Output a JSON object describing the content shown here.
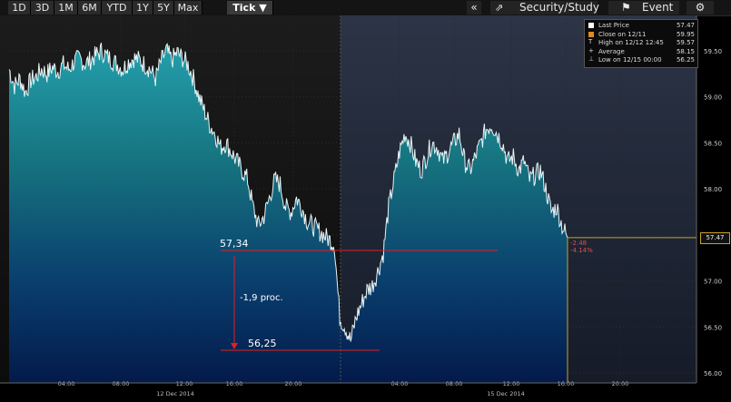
{
  "toolbar": {
    "ranges": [
      "1D",
      "3D",
      "1M",
      "6M",
      "YTD",
      "1Y",
      "5Y",
      "Max"
    ],
    "tick_label": "Tick",
    "tick_arrow": "▼",
    "collapse_label": "«",
    "security_label": "Security/Study",
    "event_label": "Event"
  },
  "legend": [
    {
      "label": "Last Price",
      "value": "57.47"
    },
    {
      "label": "Close on 12/11",
      "value": "59.95"
    },
    {
      "label": "High on 12/12 12:45",
      "value": "59.57"
    },
    {
      "label": "Average",
      "value": "58.15"
    },
    {
      "label": "Low on 12/15 00:00",
      "value": "56.25"
    }
  ],
  "price_tag": "57.47",
  "change": {
    "abs": "-2.48",
    "pct": "-4.14%"
  },
  "annotations": {
    "high_label": "57,34",
    "low_label": "56,25",
    "drop_label": "-1,9 proc."
  },
  "colors": {
    "accent_gold": "#c9a227",
    "annotation_red": "#e02020",
    "area_top": "#1f8a99",
    "area_bottom": "#04205a"
  },
  "chart_data": {
    "type": "area",
    "ylim": [
      56.0,
      59.6
    ],
    "y_ticks": [
      "59.50",
      "59.00",
      "58.50",
      "58.00",
      "57.50",
      "57.00",
      "56.50",
      "56.00"
    ],
    "x_ticks": [
      "04:00",
      "08:00",
      "12:00",
      "16:00",
      "20:00",
      "04:00",
      "08:00",
      "12:00",
      "16:00",
      "20:00"
    ],
    "day_labels": [
      "12 Dec 2014",
      "15 Dec 2014"
    ],
    "series": [
      {
        "values": [
          59.3,
          59.12,
          59.2,
          59.05,
          59.18,
          59.22,
          59.3,
          59.25,
          59.32,
          59.28,
          59.35,
          59.3,
          59.38,
          59.42,
          59.36,
          59.4,
          59.45,
          59.5,
          59.44,
          59.4,
          59.35,
          59.3,
          59.38,
          59.42,
          59.4,
          59.35,
          59.3,
          59.2,
          59.38,
          59.5,
          59.4,
          59.48,
          59.42,
          59.35,
          59.2,
          59.0,
          58.85,
          58.7,
          58.6,
          58.45,
          58.5,
          58.4,
          58.3,
          58.2,
          58.1,
          57.8,
          57.6,
          57.7,
          57.9,
          58.1,
          58.05,
          57.8,
          57.75,
          57.9,
          57.8,
          57.65,
          57.6,
          57.55,
          57.5,
          57.45,
          57.4,
          56.6,
          56.5,
          56.35,
          56.6,
          56.75,
          56.9,
          56.95,
          57.1,
          57.3,
          57.8,
          58.1,
          58.4,
          58.6,
          58.5,
          58.3,
          58.2,
          58.35,
          58.5,
          58.45,
          58.3,
          58.4,
          58.5,
          58.6,
          58.3,
          58.2,
          58.35,
          58.5,
          58.65,
          58.7,
          58.6,
          58.5,
          58.3,
          58.35,
          58.2,
          58.3,
          58.1,
          58.15,
          58.2,
          58.0,
          57.75,
          57.8,
          57.6,
          57.47
        ],
        "x_start": "12 Dec 2014 00:00",
        "x_end": "15 Dec 2014 16:00"
      }
    ],
    "reference_lines": [
      {
        "label": "57,34",
        "value": 57.34
      },
      {
        "label": "56,25",
        "value": 56.25
      }
    ]
  }
}
